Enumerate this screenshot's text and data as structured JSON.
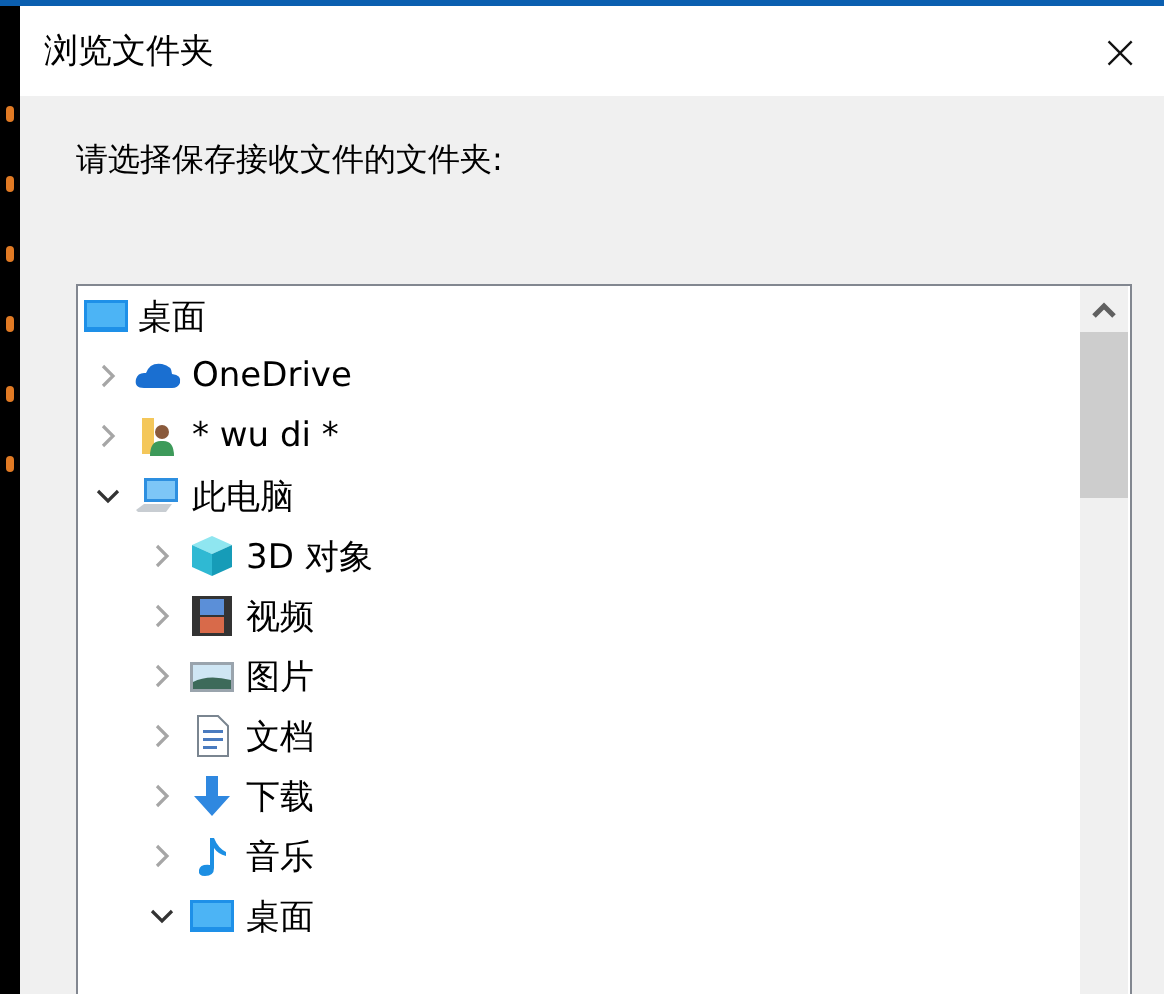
{
  "window": {
    "title": "浏览文件夹",
    "close": "×"
  },
  "prompt": "请选择保存接收文件的文件夹:",
  "tree": {
    "root": {
      "label": "桌面",
      "kind": "desktop",
      "children": [
        {
          "label": "OneDrive",
          "kind": "cloud",
          "expanded": false
        },
        {
          "label": "* wu di *",
          "kind": "user-folder",
          "expanded": false
        },
        {
          "label": "此电脑",
          "kind": "computer",
          "expanded": true,
          "children": [
            {
              "label": "3D 对象",
              "kind": "cube",
              "expanded": false
            },
            {
              "label": "视频",
              "kind": "film",
              "expanded": false
            },
            {
              "label": "图片",
              "kind": "image",
              "expanded": false
            },
            {
              "label": "文档",
              "kind": "document",
              "expanded": false
            },
            {
              "label": "下载",
              "kind": "download",
              "expanded": false
            },
            {
              "label": "音乐",
              "kind": "music",
              "expanded": false
            },
            {
              "label": "桌面",
              "kind": "desktop",
              "expanded": true
            }
          ]
        }
      ]
    }
  }
}
